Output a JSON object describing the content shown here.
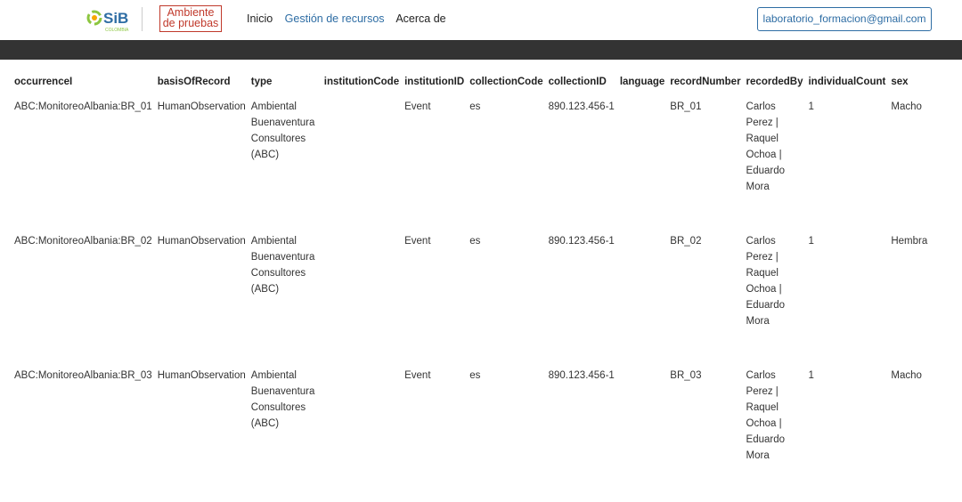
{
  "header": {
    "logo_text": "SiB",
    "logo_subtext": "COLOMBIA",
    "environment_badge": "Ambiente de pruebas",
    "nav": {
      "home": "Inicio",
      "resources": "Gestión de recursos",
      "about": "Acerca de"
    },
    "user_email": "laboratorio_formacion@gmail.com"
  },
  "colors": {
    "accent_blue": "#2e6da4",
    "badge_red": "#c0392b",
    "dark_bar": "#333333"
  },
  "table": {
    "columns": [
      "occurrenceI",
      "basisOfRecord",
      "type",
      "institutionCode",
      "institutionID",
      "collectionCode",
      "collectionID",
      "language",
      "recordNumber",
      "recordedBy",
      "individualCount",
      "sex"
    ],
    "rows": [
      [
        "ABC:MonitoreoAlbania:BR_01",
        "HumanObservation",
        "Ambiental Buenaventura Consultores (ABC)",
        "",
        "Event",
        "es",
        "890.123.456-1",
        "",
        "BR_01",
        "Carlos Perez | Raquel Ochoa | Eduardo Mora",
        "1",
        "Macho"
      ],
      [
        "ABC:MonitoreoAlbania:BR_02",
        "HumanObservation",
        "Ambiental Buenaventura Consultores (ABC)",
        "",
        "Event",
        "es",
        "890.123.456-1",
        "",
        "BR_02",
        "Carlos Perez | Raquel Ochoa | Eduardo Mora",
        "1",
        "Hembra"
      ],
      [
        "ABC:MonitoreoAlbania:BR_03",
        "HumanObservation",
        "Ambiental Buenaventura Consultores (ABC)",
        "",
        "Event",
        "es",
        "890.123.456-1",
        "",
        "BR_03",
        "Carlos Perez | Raquel Ochoa | Eduardo Mora",
        "1",
        "Macho"
      ]
    ]
  }
}
